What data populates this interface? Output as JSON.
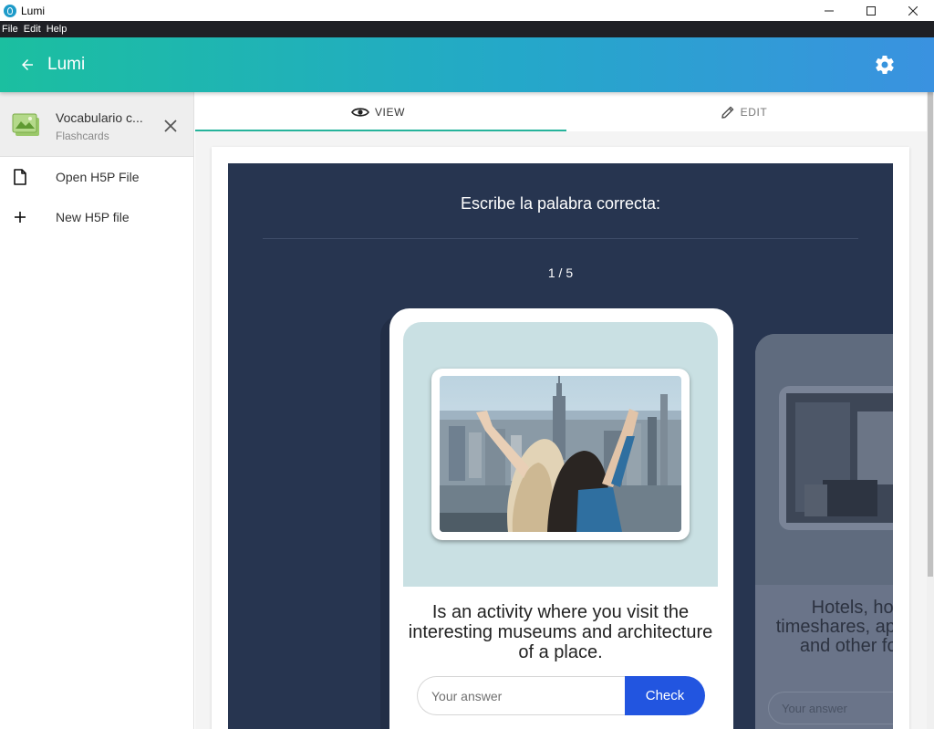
{
  "window": {
    "title": "Lumi",
    "controls": [
      "minimize",
      "maximize",
      "close"
    ]
  },
  "menu": {
    "items": [
      "File",
      "Edit",
      "Help"
    ]
  },
  "appbar": {
    "title": "Lumi",
    "back_icon": "arrow-left-icon",
    "settings_icon": "gear-icon"
  },
  "sidebar": {
    "file": {
      "name": "Vocabulario c...",
      "type": "Flashcards"
    },
    "actions": [
      {
        "label": "Open H5P File",
        "icon": "file-icon"
      },
      {
        "label": "New H5P file",
        "icon": "plus-icon"
      }
    ]
  },
  "tabs": [
    {
      "label": "VIEW",
      "icon": "eye-icon",
      "active": true
    },
    {
      "label": "EDIT",
      "icon": "pencil-icon",
      "active": false
    }
  ],
  "flashcards": {
    "description": "Escribe la palabra correcta:",
    "progress": "1 / 5",
    "current_card": {
      "text": "Is an activity where you visit the interesting museums and architecture of a place.",
      "answer_placeholder": "Your answer",
      "check_label": "Check"
    },
    "next_card": {
      "text": "Hotels, hostels, timeshares, apartments, and other forms of",
      "answer_placeholder": "Your answer"
    }
  },
  "colors": {
    "appbar_start": "#1bbfa0",
    "appbar_end": "#3a92e0",
    "h5p_background": "#273550",
    "check_button": "#2255e0",
    "tab_indicator": "#26b39b"
  }
}
